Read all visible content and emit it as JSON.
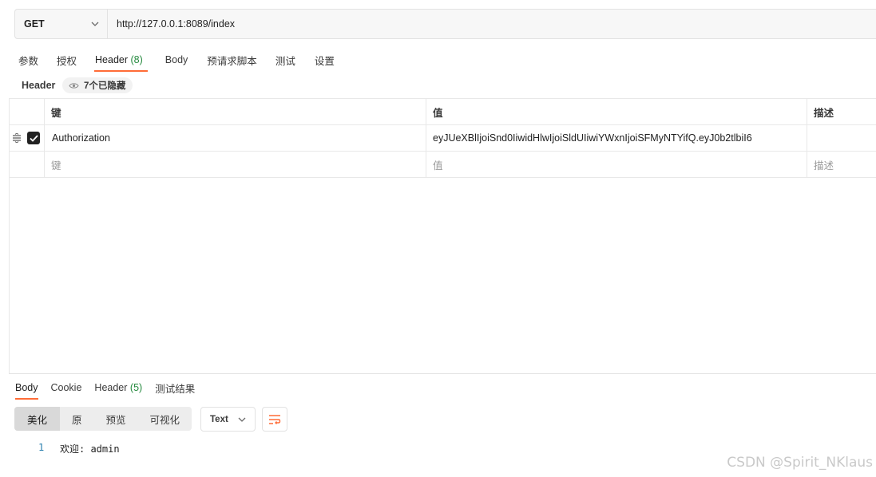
{
  "request": {
    "method": "GET",
    "url": "http://127.0.0.1:8089/index"
  },
  "request_tabs": [
    {
      "label": "参数"
    },
    {
      "label": "授权"
    },
    {
      "label": "Header",
      "count": "(8)",
      "active": true
    },
    {
      "label": "Body"
    },
    {
      "label": "预请求脚本"
    },
    {
      "label": "测试"
    },
    {
      "label": "设置"
    }
  ],
  "header_section": {
    "title": "Header",
    "hidden_label": "7个已隐藏"
  },
  "header_table": {
    "columns": {
      "key": "键",
      "value": "值",
      "description": "描述"
    },
    "rows": [
      {
        "checked": true,
        "key": "Authorization",
        "value": "eyJUeXBlIjoiSnd0IiwidHlwIjoiSldUIiwiYWxnIjoiSFMyNTYifQ.eyJ0b2tlbiI6",
        "description": ""
      }
    ],
    "placeholder": {
      "key": "键",
      "value": "值",
      "description": "描述"
    }
  },
  "response_tabs": [
    {
      "label": "Body",
      "active": true
    },
    {
      "label": "Cookie"
    },
    {
      "label": "Header",
      "count": "(5)"
    },
    {
      "label": "测试结果"
    }
  ],
  "response_view": {
    "modes": [
      "美化",
      "原",
      "预览",
      "可视化"
    ],
    "active_mode": "美化",
    "format": "Text"
  },
  "response_body": {
    "lines": [
      {
        "num": "1",
        "text": "欢迎: admin"
      }
    ]
  },
  "watermark": "CSDN @Spirit_NKlaus",
  "colors": {
    "accent": "#ff6c37",
    "count_green": "#268a3f"
  },
  "icons": [
    "chevron-down-icon",
    "eye-icon",
    "drag-handle-icon",
    "check-icon",
    "wrap-lines-icon"
  ]
}
